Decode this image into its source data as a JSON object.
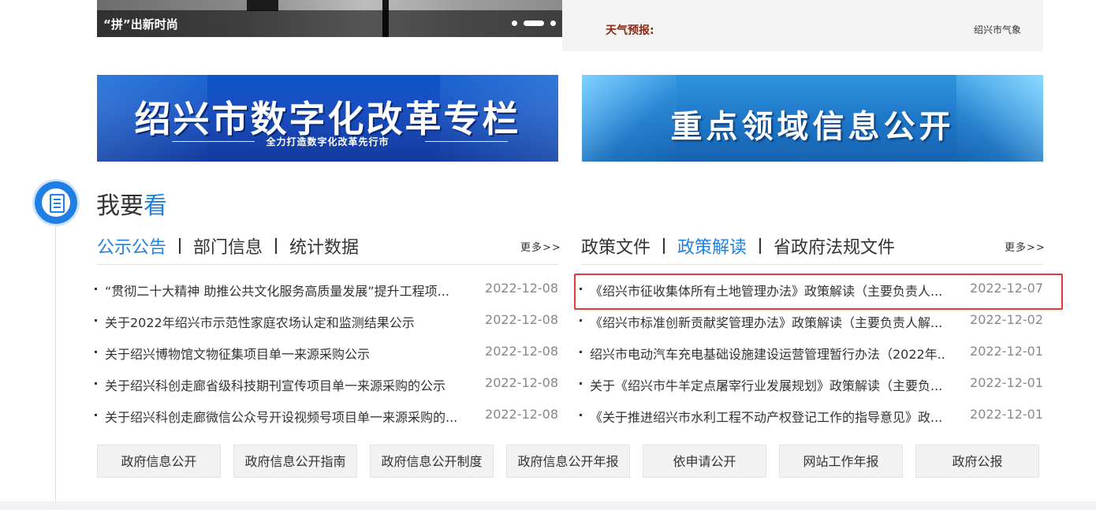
{
  "carousel": {
    "caption": "“拼”出新时尚",
    "dots": [
      "1",
      "2",
      "3",
      "4",
      "5"
    ],
    "active_dot": 1
  },
  "weather": {
    "label": "天气预报:",
    "source": "绍兴市气象"
  },
  "banners": {
    "digital_reform": {
      "title": "绍兴市数字化改革专栏",
      "subtitle": "全力打造数字化改革先行市"
    },
    "key_areas": {
      "title": "重点领域信息公开"
    }
  },
  "section": {
    "title_prefix": "我要",
    "title_highlight": "看"
  },
  "left_panel": {
    "tabs": [
      "公示公告",
      "部门信息",
      "统计数据"
    ],
    "active_tab": 0,
    "more": "更多>>",
    "items": [
      {
        "title": "“贯彻二十大精神 助推公共文化服务高质量发展”提升工程项...",
        "date": "2022-12-08"
      },
      {
        "title": "关于2022年绍兴市示范性家庭农场认定和监测结果公示",
        "date": "2022-12-08"
      },
      {
        "title": "关于绍兴博物馆文物征集项目单一来源采购公示",
        "date": "2022-12-08"
      },
      {
        "title": "关于绍兴科创走廊省级科技期刊宣传项目单一来源采购的公示",
        "date": "2022-12-08"
      },
      {
        "title": "关于绍兴科创走廊微信公众号开设视频号项目单一来源采购的...",
        "date": "2022-12-08"
      }
    ]
  },
  "right_panel": {
    "tabs": [
      "政策文件",
      "政策解读",
      "省政府法规文件"
    ],
    "active_tab": 1,
    "more": "更多>>",
    "items": [
      {
        "title": "《绍兴市征收集体所有土地管理办法》政策解读（主要负责人...",
        "date": "2022-12-07"
      },
      {
        "title": "《绍兴市标准创新贡献奖管理办法》政策解读（主要负责人解...",
        "date": "2022-12-02"
      },
      {
        "title": "绍兴市电动汽车充电基础设施建设运营管理暂行办法（2022年...",
        "date": "2022-12-01"
      },
      {
        "title": "关于《绍兴市牛羊定点屠宰行业发展规划》政策解读（主要负...",
        "date": "2022-12-01"
      },
      {
        "title": "《关于推进绍兴市水利工程不动产权登记工作的指导意见》政...",
        "date": "2022-12-01"
      }
    ]
  },
  "bottom_links": [
    "政府信息公开",
    "政府信息公开指南",
    "政府信息公开制度",
    "政府信息公开年报",
    "依申请公开",
    "网站工作年报",
    "政府公报"
  ],
  "colors": {
    "accent": "#1f82e0",
    "highlight_border": "#e53935",
    "weather_label": "#8b2a14"
  }
}
